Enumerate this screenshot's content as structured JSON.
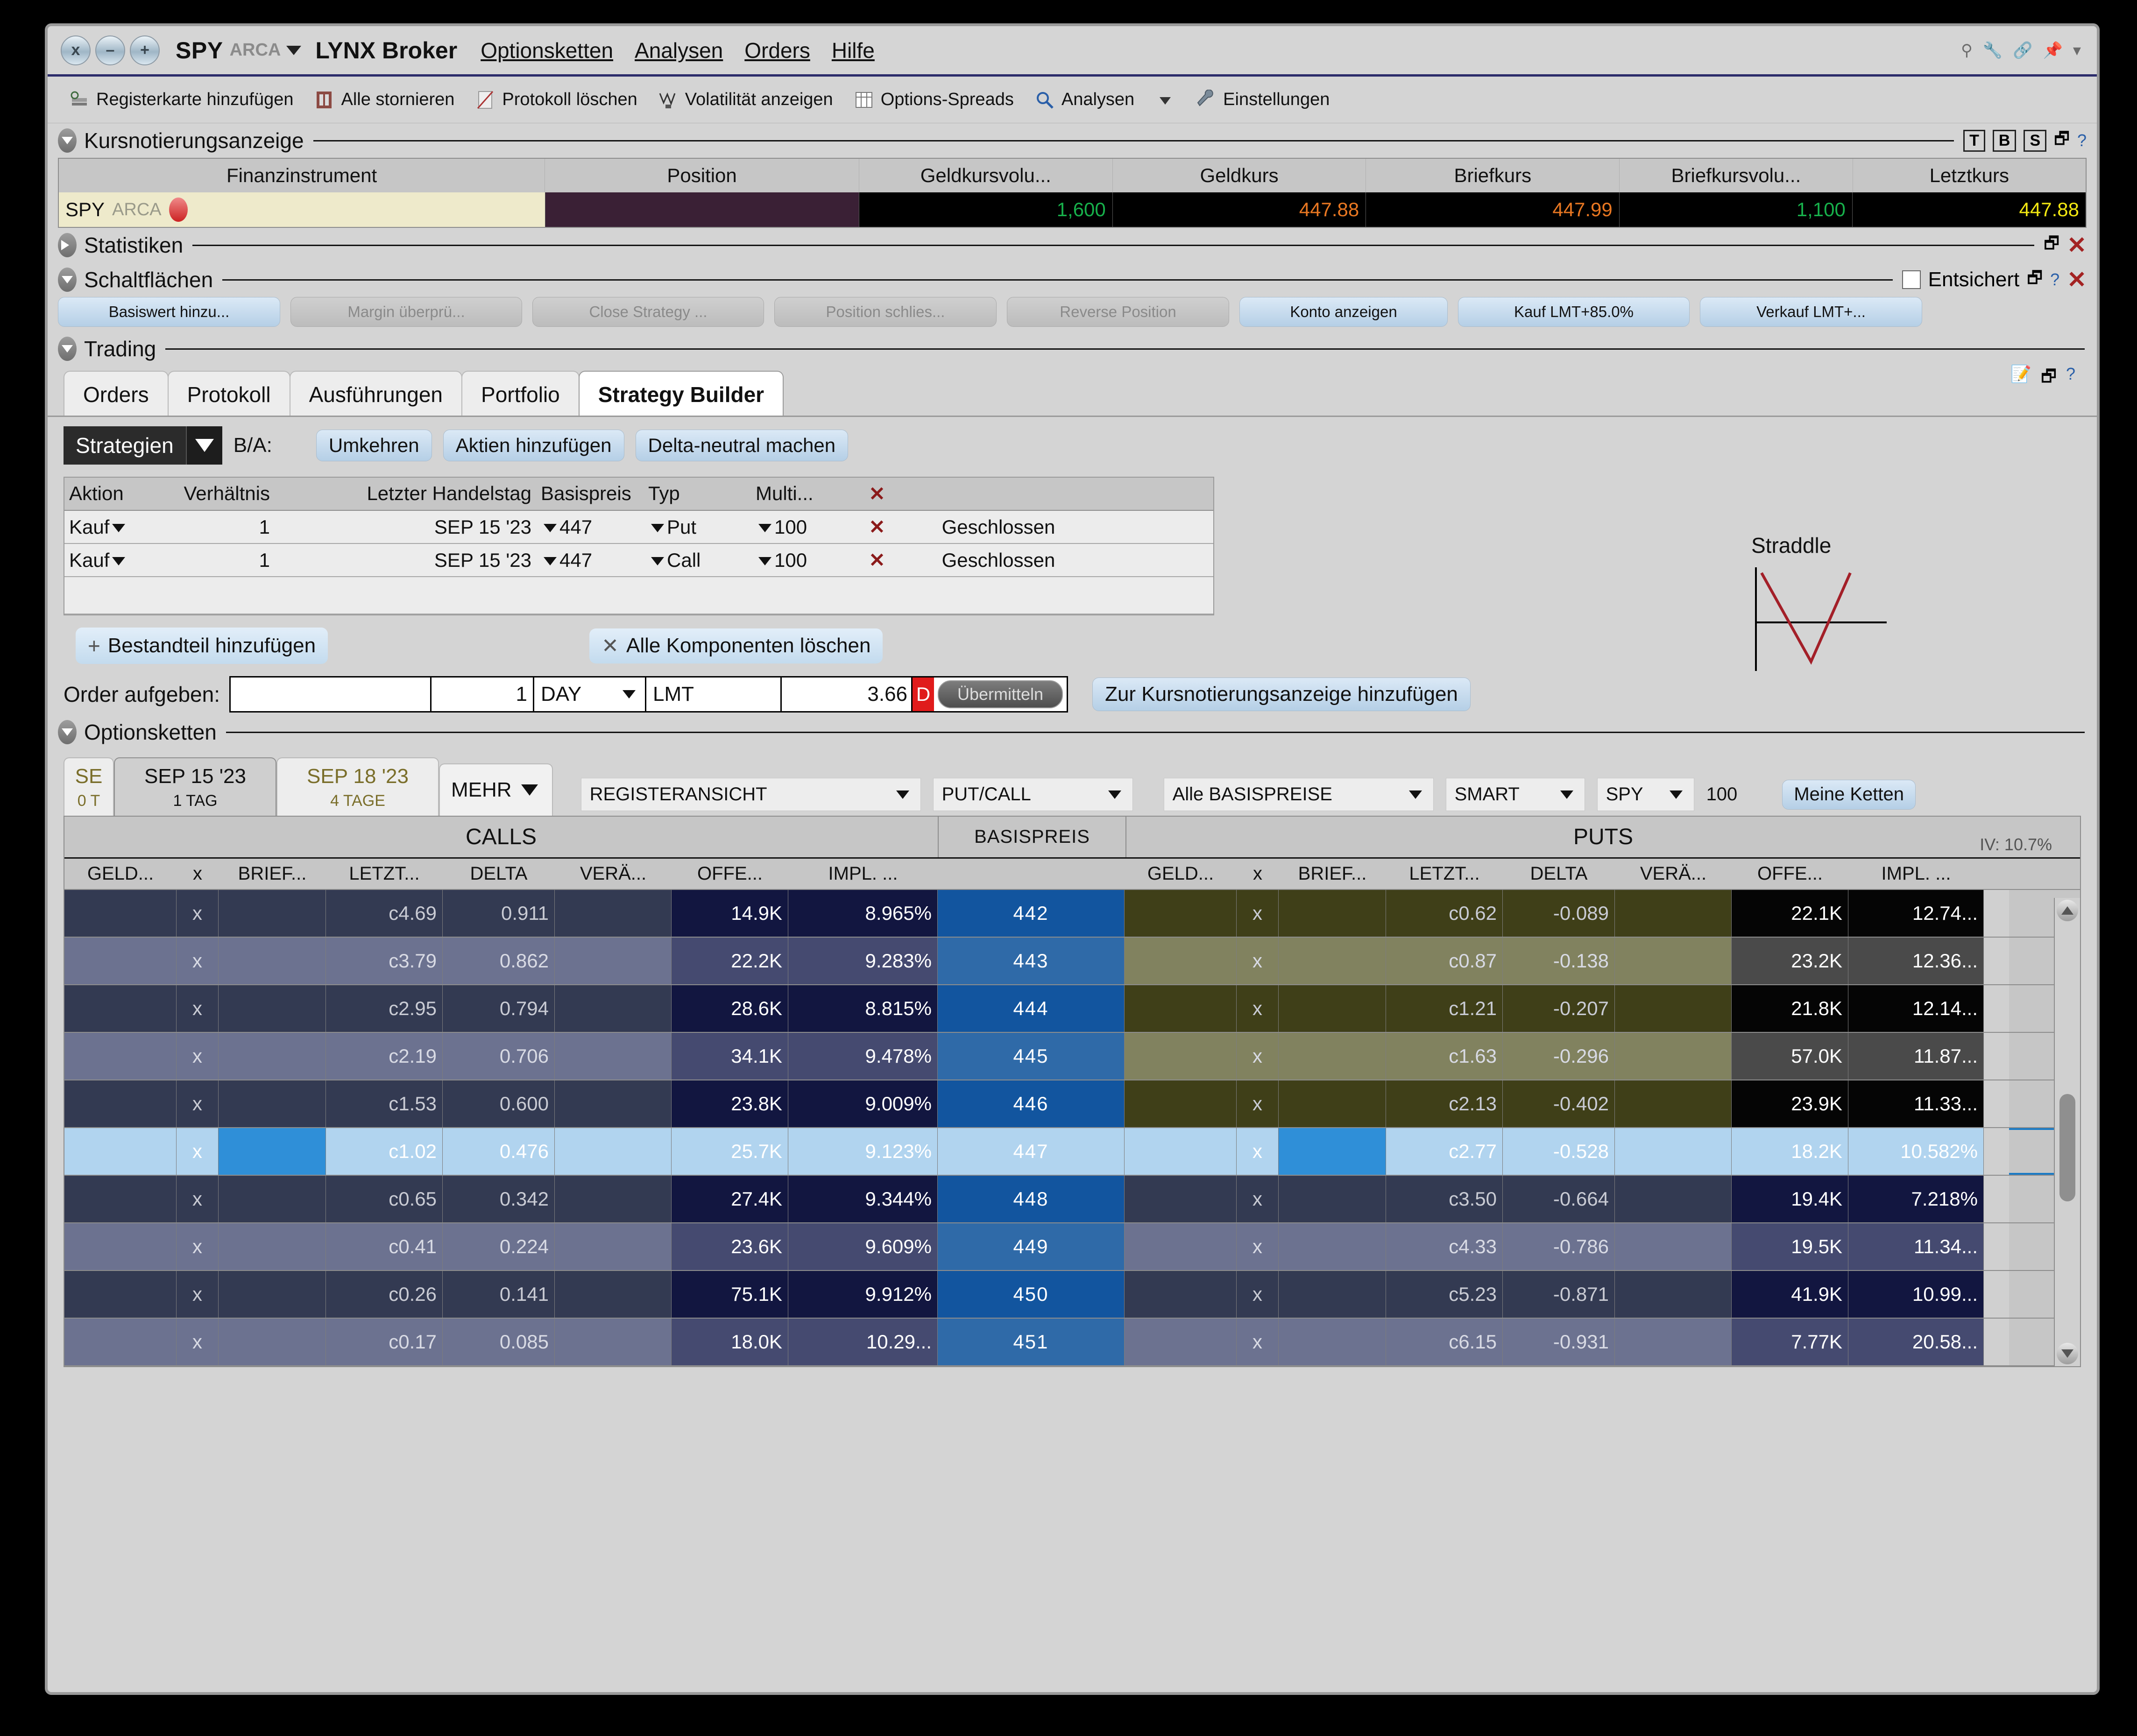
{
  "window": {
    "symbol": "SPY",
    "exchange": "ARCA",
    "broker": "LYNX Broker",
    "buttons": {
      "close": "x",
      "min": "–",
      "max": "+"
    },
    "menu": [
      "Optionsketten",
      "Analysen",
      "Orders",
      "Hilfe"
    ]
  },
  "toolbar": [
    {
      "label": "Registerkarte hinzufügen",
      "icon": "add-tab-icon"
    },
    {
      "label": "Alle stornieren",
      "icon": "cancel-all-icon"
    },
    {
      "label": "Protokoll löschen",
      "icon": "clear-log-icon"
    },
    {
      "label": "Volatilität anzeigen",
      "icon": "volatility-icon"
    },
    {
      "label": "Options-Spreads",
      "icon": "spreads-icon"
    },
    {
      "label": "Analysen",
      "icon": "analysis-icon"
    },
    {
      "label": "",
      "icon": "chevron-down-icon"
    },
    {
      "label": "Einstellungen",
      "icon": "wrench-icon"
    }
  ],
  "quote_panel": {
    "title": "Kursnotierungsanzeige",
    "view_buttons": [
      "T",
      "B",
      "S"
    ],
    "columns": [
      "Finanzinstrument",
      "Position",
      "Geldkursvolu...",
      "Geldkurs",
      "Briefkurs",
      "Briefkursvolu...",
      "Letztkurs"
    ],
    "row": {
      "instrument": "SPY",
      "exchange": "ARCA",
      "position": "",
      "bid_size": "1,600",
      "bid": "447.88",
      "ask": "447.99",
      "ask_size": "1,100",
      "last": "447.88"
    },
    "colors": {
      "bid_size": "#17b04b",
      "bid": "#e87722",
      "ask": "#e87722",
      "ask_size": "#17b04b",
      "last": "#f2e712"
    }
  },
  "statistics": {
    "title": "Statistiken"
  },
  "buttons_panel": {
    "title": "Schaltflächen",
    "unlock_label": "Entsichert",
    "buttons": [
      {
        "label": "Basiswert hinzu...",
        "enabled": true
      },
      {
        "label": "Margin überprü...",
        "enabled": false
      },
      {
        "label": "Close Strategy ...",
        "enabled": false
      },
      {
        "label": "Position schlies...",
        "enabled": false
      },
      {
        "label": "Reverse Position",
        "enabled": false
      },
      {
        "label": "Konto anzeigen",
        "enabled": true
      },
      {
        "label": "Kauf LMT+85.0%",
        "enabled": true
      },
      {
        "label": "Verkauf LMT+...",
        "enabled": true
      }
    ]
  },
  "trading": {
    "title": "Trading",
    "tabs": [
      "Orders",
      "Protokoll",
      "Ausführungen",
      "Portfolio",
      "Strategy Builder"
    ],
    "active_tab": "Strategy Builder"
  },
  "strategy_builder": {
    "strategies_label": "Strategien",
    "ba_label": "B/A:",
    "actions": [
      "Umkehren",
      "Aktien hinzufügen",
      "Delta-neutral machen"
    ],
    "strategy_name": "Straddle",
    "legs_columns": [
      "Aktion",
      "Verhältnis",
      "Letzter Handelstag",
      "Basispreis",
      "Typ",
      "Multi...",
      "✕"
    ],
    "legs": [
      {
        "action": "Kauf",
        "ratio": "1",
        "expiry": "SEP 15 '23",
        "strike": "447",
        "type": "Put",
        "multiplier": "100",
        "status": "Geschlossen"
      },
      {
        "action": "Kauf",
        "ratio": "1",
        "expiry": "SEP 15 '23",
        "strike": "447",
        "type": "Call",
        "multiplier": "100",
        "status": "Geschlossen"
      }
    ],
    "add_component": "Bestandteil hinzufügen",
    "delete_all": "Alle Komponenten löschen"
  },
  "order": {
    "label": "Order aufgeben:",
    "account": "",
    "quantity": "1",
    "tif": "DAY",
    "order_type": "LMT",
    "price": "3.66",
    "destination_badge": "D",
    "submit_label": "Übermitteln",
    "add_to_quote": "Zur Kursnotierungsanzeige hinzufügen"
  },
  "option_chains": {
    "title": "Optionsketten",
    "expiry_tabs": [
      {
        "date": "SE",
        "days": "0 T",
        "active": false,
        "clipped": true
      },
      {
        "date": "SEP 15 '23",
        "days": "1 TAG",
        "active": true
      },
      {
        "date": "SEP 18 '23",
        "days": "4 TAGE",
        "active": false
      }
    ],
    "more_label": "MEHR",
    "filters": {
      "view": "REGISTERANSICHT",
      "put_call": "PUT/CALL",
      "strikes": "Alle BASISPREISE",
      "routing": "SMART",
      "underlying": "SPY",
      "multiplier": "100",
      "my_chains": "Meine Ketten"
    },
    "groups": {
      "calls": "CALLS",
      "strike": "BASISPREIS",
      "puts": "PUTS"
    },
    "iv_label": "IV: 10.7%",
    "columns": [
      "GELD...",
      "x",
      "BRIEF...",
      "LETZT...",
      "DELTA",
      "VERÄ...",
      "OFFE...",
      "IMPL. ..."
    ]
  },
  "chart_data": {
    "type": "table",
    "title": "SPY Optionskette SEP 15 '23",
    "columns": [
      "call_bid",
      "call_x",
      "call_ask",
      "call_last",
      "call_delta",
      "call_change",
      "call_oi",
      "call_iv",
      "strike",
      "put_bid",
      "put_x",
      "put_ask",
      "put_last",
      "put_delta",
      "put_change",
      "put_oi",
      "put_iv"
    ],
    "rows": [
      {
        "call_bid": "",
        "call_x": "x",
        "call_ask": "",
        "call_last": "c4.69",
        "call_delta": "0.911",
        "call_change": "",
        "call_oi": "14.9K",
        "call_iv": "8.965%",
        "strike": "442",
        "put_bid": "",
        "put_x": "x",
        "put_ask": "",
        "put_last": "c0.62",
        "put_delta": "-0.089",
        "put_change": "",
        "put_oi": "22.1K",
        "put_iv": "12.74...",
        "band": "dark",
        "selected": false
      },
      {
        "call_bid": "",
        "call_x": "x",
        "call_ask": "",
        "call_last": "c3.79",
        "call_delta": "0.862",
        "call_change": "",
        "call_oi": "22.2K",
        "call_iv": "9.283%",
        "strike": "443",
        "put_bid": "",
        "put_x": "x",
        "put_ask": "",
        "put_last": "c0.87",
        "put_delta": "-0.138",
        "put_change": "",
        "put_oi": "23.2K",
        "put_iv": "12.36...",
        "band": "light",
        "selected": false
      },
      {
        "call_bid": "",
        "call_x": "x",
        "call_ask": "",
        "call_last": "c2.95",
        "call_delta": "0.794",
        "call_change": "",
        "call_oi": "28.6K",
        "call_iv": "8.815%",
        "strike": "444",
        "put_bid": "",
        "put_x": "x",
        "put_ask": "",
        "put_last": "c1.21",
        "put_delta": "-0.207",
        "put_change": "",
        "put_oi": "21.8K",
        "put_iv": "12.14...",
        "band": "dark",
        "selected": false
      },
      {
        "call_bid": "",
        "call_x": "x",
        "call_ask": "",
        "call_last": "c2.19",
        "call_delta": "0.706",
        "call_change": "",
        "call_oi": "34.1K",
        "call_iv": "9.478%",
        "strike": "445",
        "put_bid": "",
        "put_x": "x",
        "put_ask": "",
        "put_last": "c1.63",
        "put_delta": "-0.296",
        "put_change": "",
        "put_oi": "57.0K",
        "put_iv": "11.87...",
        "band": "light",
        "selected": false
      },
      {
        "call_bid": "",
        "call_x": "x",
        "call_ask": "",
        "call_last": "c1.53",
        "call_delta": "0.600",
        "call_change": "",
        "call_oi": "23.8K",
        "call_iv": "9.009%",
        "strike": "446",
        "put_bid": "",
        "put_x": "x",
        "put_ask": "",
        "put_last": "c2.13",
        "put_delta": "-0.402",
        "put_change": "",
        "put_oi": "23.9K",
        "put_iv": "11.33...",
        "band": "dark",
        "selected": false
      },
      {
        "call_bid": "",
        "call_x": "x",
        "call_ask": "",
        "call_last": "c1.02",
        "call_delta": "0.476",
        "call_change": "",
        "call_oi": "25.7K",
        "call_iv": "9.123%",
        "strike": "447",
        "put_bid": "",
        "put_x": "x",
        "put_ask": "",
        "put_last": "c2.77",
        "put_delta": "-0.528",
        "put_change": "",
        "put_oi": "18.2K",
        "put_iv": "10.582%",
        "band": "selected",
        "selected": true
      },
      {
        "call_bid": "",
        "call_x": "x",
        "call_ask": "",
        "call_last": "c0.65",
        "call_delta": "0.342",
        "call_change": "",
        "call_oi": "27.4K",
        "call_iv": "9.344%",
        "strike": "448",
        "put_bid": "",
        "put_x": "x",
        "put_ask": "",
        "put_last": "c3.50",
        "put_delta": "-0.664",
        "put_change": "",
        "put_oi": "19.4K",
        "put_iv": "7.218%",
        "band": "dark",
        "selected": false
      },
      {
        "call_bid": "",
        "call_x": "x",
        "call_ask": "",
        "call_last": "c0.41",
        "call_delta": "0.224",
        "call_change": "",
        "call_oi": "23.6K",
        "call_iv": "9.609%",
        "strike": "449",
        "put_bid": "",
        "put_x": "x",
        "put_ask": "",
        "put_last": "c4.33",
        "put_delta": "-0.786",
        "put_change": "",
        "put_oi": "19.5K",
        "put_iv": "11.34...",
        "band": "light",
        "selected": false
      },
      {
        "call_bid": "",
        "call_x": "x",
        "call_ask": "",
        "call_last": "c0.26",
        "call_delta": "0.141",
        "call_change": "",
        "call_oi": "75.1K",
        "call_iv": "9.912%",
        "strike": "450",
        "put_bid": "",
        "put_x": "x",
        "put_ask": "",
        "put_last": "c5.23",
        "put_delta": "-0.871",
        "put_change": "",
        "put_oi": "41.9K",
        "put_iv": "10.99...",
        "band": "dark",
        "selected": false
      },
      {
        "call_bid": "",
        "call_x": "x",
        "call_ask": "",
        "call_last": "c0.17",
        "call_delta": "0.085",
        "call_change": "",
        "call_oi": "18.0K",
        "call_iv": "10.29...",
        "strike": "451",
        "put_bid": "",
        "put_x": "x",
        "put_ask": "",
        "put_last": "c6.15",
        "put_delta": "-0.931",
        "put_change": "",
        "put_oi": "7.77K",
        "put_iv": "20.58...",
        "band": "light",
        "selected": false
      }
    ]
  }
}
